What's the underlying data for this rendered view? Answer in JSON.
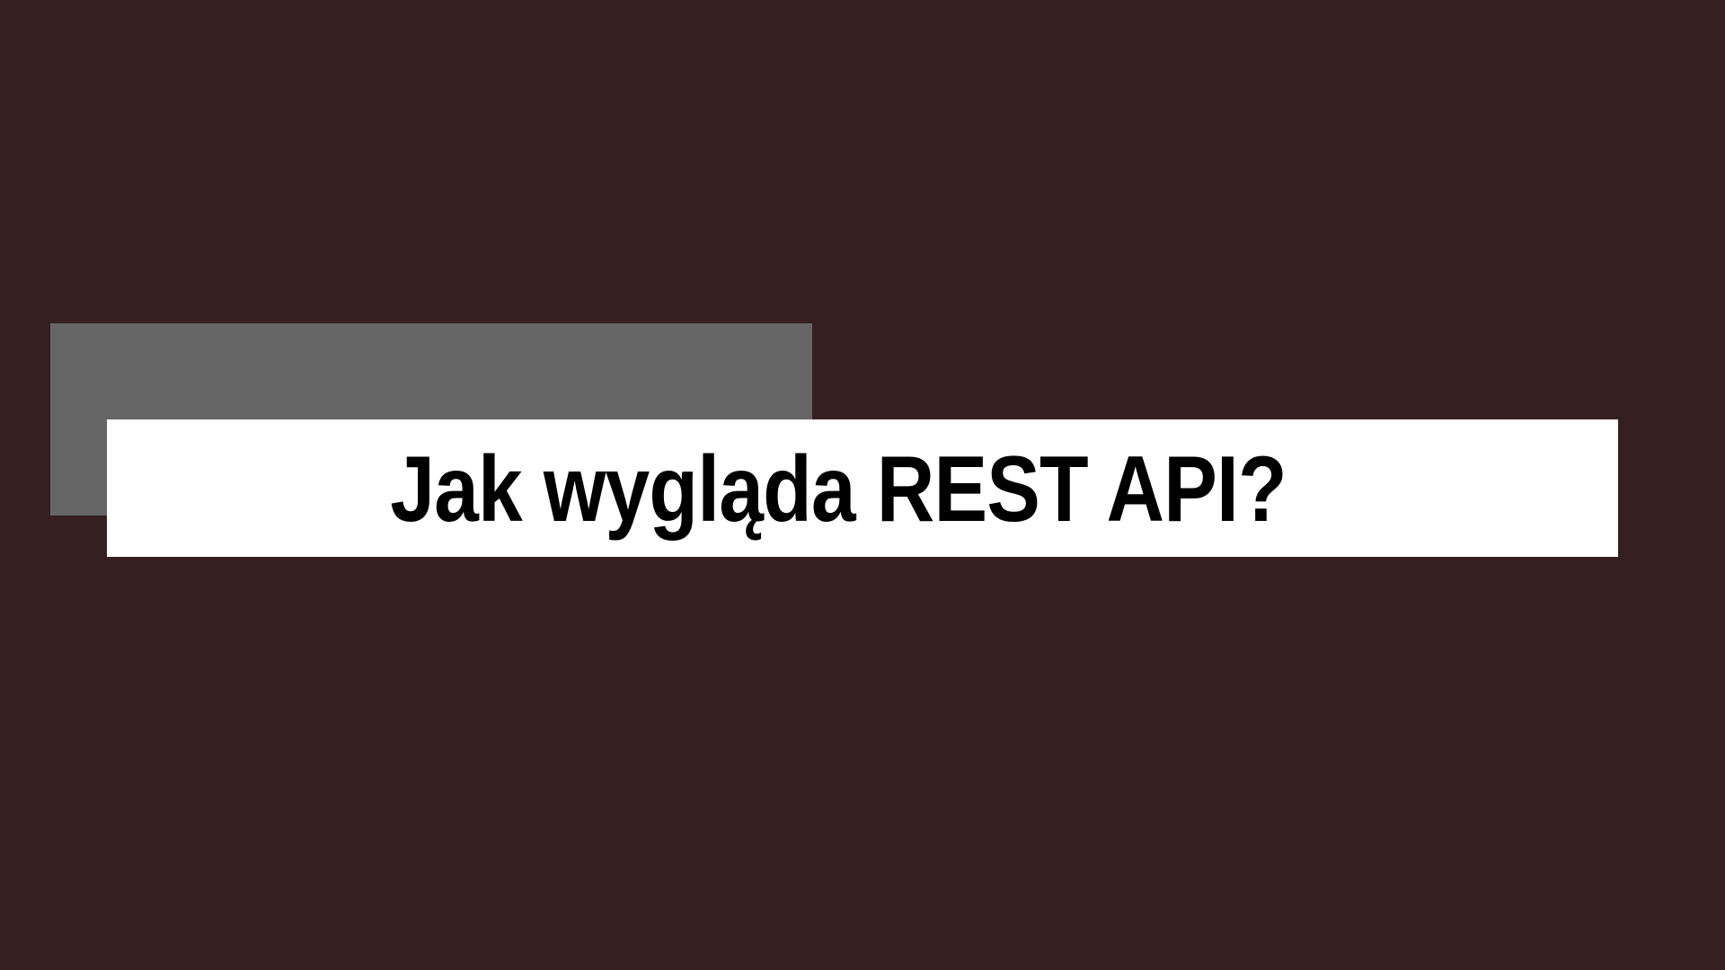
{
  "slide": {
    "title": "Jak wygląda REST API?",
    "colors": {
      "background": "#361f20",
      "accent_block": "#666666",
      "title_band": "#ffffff",
      "title_text": "#000000"
    }
  }
}
